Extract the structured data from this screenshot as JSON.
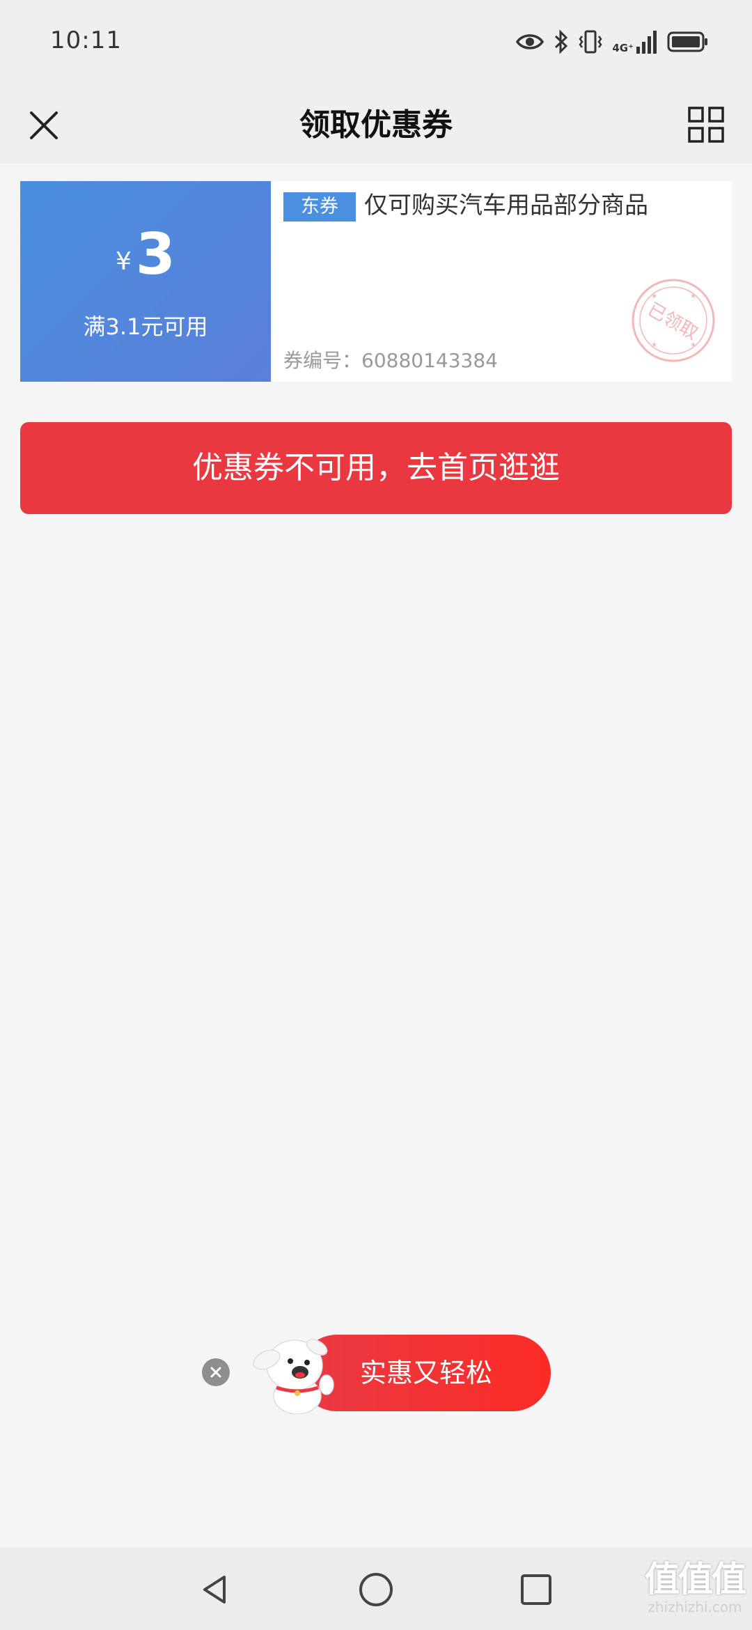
{
  "status_bar": {
    "time": "10:11",
    "network": "4G⁺",
    "icons": [
      "eye-icon",
      "bluetooth-icon",
      "vibrate-icon",
      "signal-icon",
      "battery-icon"
    ]
  },
  "header": {
    "title": "领取优惠券",
    "close_icon": "close-icon",
    "menu_icon": "grid-icon"
  },
  "coupon": {
    "currency": "¥",
    "amount": "3",
    "threshold": "满3.1元可用",
    "badge": "东券",
    "description": "仅可购买汽车用品部分商品",
    "code_label": "券编号：",
    "code": "60880143384",
    "stamp_text": "已领取",
    "colors": {
      "left_bg": "#4a8fe0",
      "badge_bg": "#4a8fe0"
    }
  },
  "main_button": {
    "label": "优惠券不可用，去首页逛逛",
    "color": "#e9383f"
  },
  "promo": {
    "label": "实惠又轻松",
    "mascot": "jd-dog-mascot",
    "color": "#f0302f"
  },
  "nav": {
    "icons": [
      "back-icon",
      "home-icon",
      "recent-apps-icon"
    ]
  },
  "watermark": {
    "big": "值值值",
    "small": "zhizhizhi.com"
  }
}
